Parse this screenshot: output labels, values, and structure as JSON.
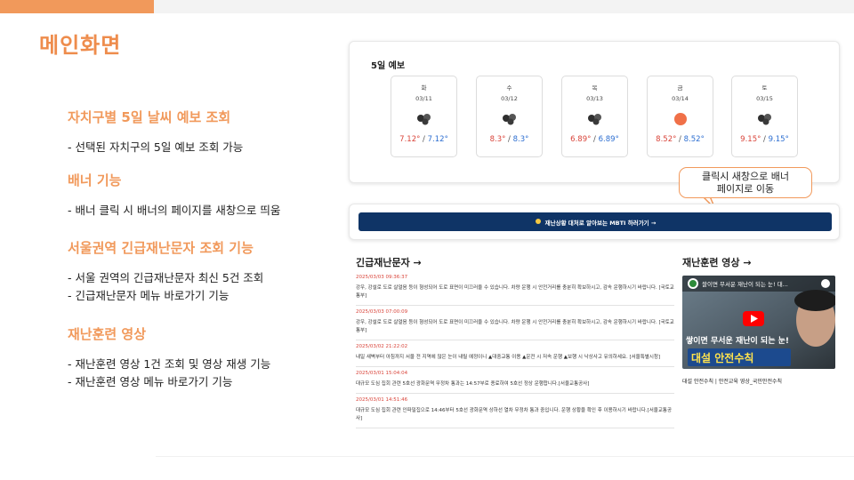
{
  "page_title": "메인화면",
  "features": [
    {
      "title": "자치구별  5일 날씨 예보 조회",
      "items": [
        "선택된 자치구의 5일 예보 조회 가능"
      ]
    },
    {
      "title": "배너 기능",
      "items": [
        "배너 클릭 시 배너의 페이지를 새창으로 띄움"
      ]
    },
    {
      "title": "서울권역 긴급재난문자 조회 기능",
      "items": [
        "서울 권역의 긴급재난문자 최신 5건 조회",
        "긴급재난문자 메뉴 바로가기 기능"
      ]
    },
    {
      "title": "재난훈련 영상",
      "items": [
        "재난훈련 영상 1건 조회 및 영상 재생 기능",
        "재난훈련 영상 메뉴 바로가기 기능"
      ]
    }
  ],
  "forecast": {
    "heading": "5일 예보",
    "days": [
      {
        "day": "화",
        "date": "03/11",
        "icon": "cloud-icon",
        "max": "7.12°",
        "min": "7.12°"
      },
      {
        "day": "수",
        "date": "03/12",
        "icon": "cloud-icon",
        "max": "8.3°",
        "min": "8.3°"
      },
      {
        "day": "목",
        "date": "03/13",
        "icon": "cloud-icon",
        "max": "6.89°",
        "min": "6.89°"
      },
      {
        "day": "금",
        "date": "03/14",
        "icon": "sun-icon",
        "max": "8.52°",
        "min": "8.52°"
      },
      {
        "day": "토",
        "date": "03/15",
        "icon": "cloud-icon",
        "max": "9.15°",
        "min": "9.15°"
      }
    ],
    "separator": " / "
  },
  "callout": {
    "line1": "클릭시 새창으로 배너",
    "line2": "페이지로 이동"
  },
  "banner": {
    "icon": "sun-icon",
    "label": "재난상황 대처로 알아보는 MBTI 하러가기 →"
  },
  "alerts": {
    "title": "긴급재난문자 →",
    "items": [
      {
        "time": "2025/03/03 09:36:37",
        "msg": "강우, 강설로 도로 살얼음 등이 형성되어 도로 표면이 미끄러울 수 있습니다. 차량 운행 시 안전거리를 충분히 확보하시고, 감속 운행하시기 바랍니다. [국토교통부]"
      },
      {
        "time": "2025/03/03 07:00:09",
        "msg": "강우, 강설로 도로 살얼음 등이 형성되어 도로 표면이 미끄러울 수 있습니다. 차량 운행 시 안전거리를 충분히 확보하시고, 감속 운행하시기 바랍니다. [국토교통부]"
      },
      {
        "time": "2025/03/02 21:22:02",
        "msg": "내일 새벽부터 아침까지 서울 전 지역에 많은 눈이 내릴 예정이니 ▲대중교통 이용 ▲운전 시 저속 운행 ▲보행 시 낙상사고 유의하세요. [서울특별시청]"
      },
      {
        "time": "2025/03/01 15:04:04",
        "msg": "대규모 도심 집회 관련 5호선 광화문역 무정차 통과는 14:57부로 종료하여 5호선 정상 운행합니다.[서울교통공사]"
      },
      {
        "time": "2025/03/01 14:51:46",
        "msg": "대규모 도심 집회 관련 인파밀집으로 14:46부터 5호선 광화문역 상하선 열차 무정차 통과 중입니다. 운행 상황을 확인 후 이용하시기 바랍니다.[서울교통공사]"
      }
    ]
  },
  "video": {
    "title": "재난훈련 영상 →",
    "thumb_top_text": "쌀이면 무서운 재난이 되는 눈! 대...",
    "thumb_mid_text": "쌓이면 무서운 재난이 되는 눈!",
    "thumb_big_text": "대설 안전수칙",
    "channel_badge": "국민안전TV",
    "caption": "대설 안전수칙 | 안전교육 영상_국민안전수칙"
  },
  "colors": {
    "accent": "#f1995b",
    "banner": "#0f3466",
    "temp_max": "#d9443a",
    "temp_min": "#2e6fd1",
    "alert_time": "#d9443a"
  }
}
